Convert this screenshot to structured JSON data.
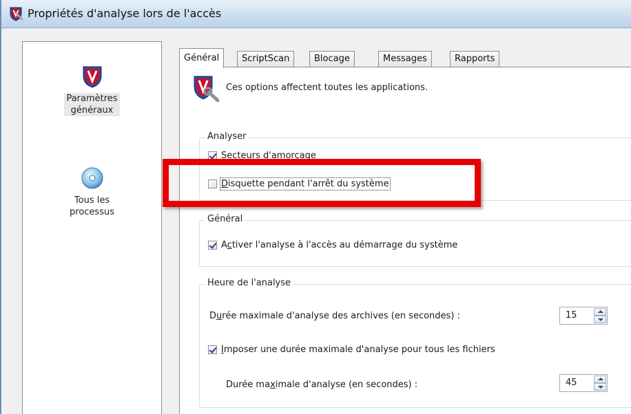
{
  "window": {
    "title": "Propriétés d'analyse lors de l'accès"
  },
  "sidebar": {
    "items": [
      {
        "label_line1": "Paramètres",
        "label_line2": "généraux",
        "icon": "mcafee-shield-icon",
        "selected": true
      },
      {
        "label_line1": "Tous les",
        "label_line2": "processus",
        "icon": "disc-icon",
        "selected": false
      }
    ]
  },
  "tabs": [
    {
      "label": "Général",
      "active": true
    },
    {
      "label": "ScriptScan",
      "active": false
    },
    {
      "label": "Blocage",
      "active": false
    },
    {
      "label": "Messages",
      "active": false
    },
    {
      "label": "Rapports",
      "active": false
    }
  ],
  "intro": {
    "text": "Ces options affectent toutes les applications.",
    "icon": "shield-wrench-icon"
  },
  "analyser": {
    "title": "Analyser",
    "boot_sectors": {
      "pre": "",
      "u": "S",
      "post": "ecteurs d'amorçage",
      "checked": true
    },
    "floppy": {
      "pre": "",
      "u": "D",
      "post": "isquette pendant l'arrêt du système",
      "checked": false
    }
  },
  "general": {
    "title": "Général",
    "enable_startup": {
      "pre": "A",
      "u": "c",
      "post": "tiver l'analyse à l'accès au démarrage du système",
      "checked": true
    }
  },
  "timing": {
    "title": "Heure de l'analyse",
    "archive_label": {
      "pre": "D",
      "u": "u",
      "post": "rée maximale d'analyse des archives (en secondes) :"
    },
    "archive_value": "15",
    "enforce_max": {
      "pre": "",
      "u": "I",
      "post": "mposer une durée maximale d'analyse pour tous les fichiers",
      "checked": true
    },
    "max_label": {
      "pre": "Durée ma",
      "u": "x",
      "post": "imale d'analyse (en secondes) :"
    },
    "max_value": "45"
  },
  "colors": {
    "highlight_box": "#e80000",
    "accent": "#2b3e91"
  }
}
